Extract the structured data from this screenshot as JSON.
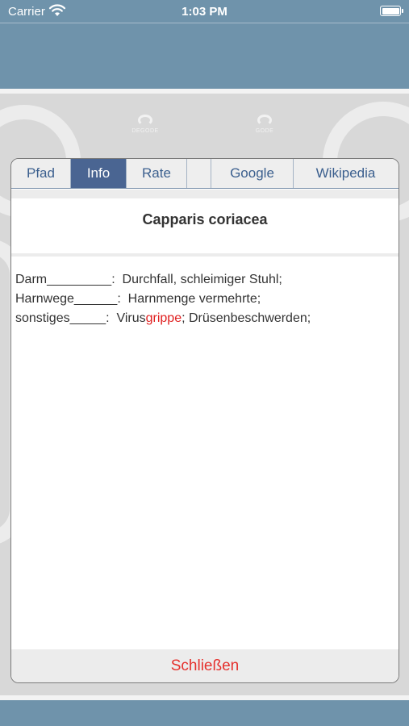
{
  "status_bar": {
    "carrier": "Carrier",
    "time": "1:03 PM"
  },
  "background_logos": {
    "left": "DEGODE",
    "right": "GODE"
  },
  "tabs": [
    {
      "label": "Pfad",
      "active": false
    },
    {
      "label": "Info",
      "active": true
    },
    {
      "label": "Rate",
      "active": false
    },
    {
      "label": "",
      "active": false
    },
    {
      "label": "Google",
      "active": false
    },
    {
      "label": "Wikipedia",
      "active": false
    }
  ],
  "title": "Capparis coriacea",
  "rows": [
    {
      "label": "Darm_________",
      "text_before": "Durchfall, schleimiger Stuhl;",
      "highlight": "",
      "text_after": ""
    },
    {
      "label": "Harnwege______",
      "text_before": "Harnmenge vermehrte;",
      "highlight": "",
      "text_after": ""
    },
    {
      "label": "sonstiges_____",
      "text_before": "Virus",
      "highlight": "grippe",
      "text_after": "; Drüsenbeschwerden;"
    }
  ],
  "close_label": "Schließen",
  "colors": {
    "band": "#6f93ab",
    "active_tab": "#4a6592",
    "tab_text": "#3b5f8e",
    "highlight": "#e02020",
    "close": "#e5312d"
  }
}
